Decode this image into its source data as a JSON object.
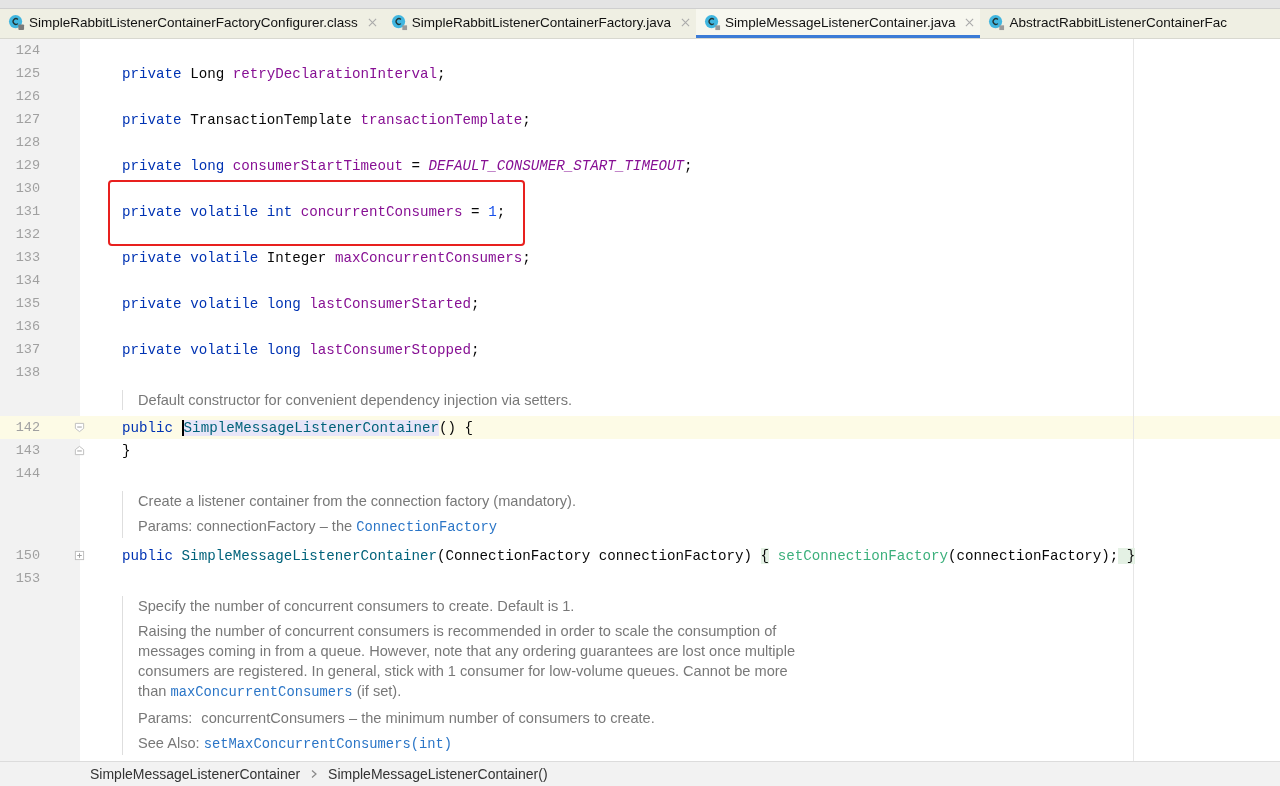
{
  "tabs": [
    {
      "label": "SimpleRabbitListenerContainerFactoryConfigurer.class",
      "kind": "class",
      "selected": false,
      "closable": true
    },
    {
      "label": "SimpleRabbitListenerContainerFactory.java",
      "kind": "java",
      "selected": false,
      "closable": true
    },
    {
      "label": "SimpleMessageListenerContainer.java",
      "kind": "java",
      "selected": true,
      "closable": true
    },
    {
      "label": "AbstractRabbitListenerContainerFac",
      "kind": "java",
      "selected": false,
      "closable": false
    }
  ],
  "lines": [
    {
      "kind": "code",
      "number": "124"
    },
    {
      "kind": "code",
      "number": "125",
      "tokens": [
        {
          "t": "private ",
          "kind": "keyword"
        },
        {
          "t": "Long ",
          "kind": "text"
        },
        {
          "t": "retryDeclarationInterval",
          "kind": "field"
        },
        {
          "t": ";",
          "kind": "text"
        }
      ]
    },
    {
      "kind": "code",
      "number": "126"
    },
    {
      "kind": "code",
      "number": "127",
      "tokens": [
        {
          "t": "private ",
          "kind": "keyword"
        },
        {
          "t": "TransactionTemplate ",
          "kind": "text"
        },
        {
          "t": "transactionTemplate",
          "kind": "field"
        },
        {
          "t": ";",
          "kind": "text"
        }
      ]
    },
    {
      "kind": "code",
      "number": "128"
    },
    {
      "kind": "code",
      "number": "129",
      "tokens": [
        {
          "t": "private ",
          "kind": "keyword"
        },
        {
          "t": "long ",
          "kind": "keyword"
        },
        {
          "t": "consumerStartTimeout",
          "kind": "field"
        },
        {
          "t": " = ",
          "kind": "text"
        },
        {
          "t": "DEFAULT_CONSUMER_START_TIMEOUT",
          "kind": "constant"
        },
        {
          "t": ";",
          "kind": "text"
        }
      ]
    },
    {
      "kind": "code",
      "number": "130"
    },
    {
      "kind": "code",
      "number": "131",
      "marked": true,
      "tokens": [
        {
          "t": "private ",
          "kind": "keyword"
        },
        {
          "t": "volatile ",
          "kind": "keyword"
        },
        {
          "t": "int ",
          "kind": "keyword"
        },
        {
          "t": "concurrentConsumers",
          "kind": "field"
        },
        {
          "t": " = ",
          "kind": "text"
        },
        {
          "t": "1",
          "kind": "number"
        },
        {
          "t": ";",
          "kind": "text"
        }
      ]
    },
    {
      "kind": "code",
      "number": "132"
    },
    {
      "kind": "code",
      "number": "133",
      "tokens": [
        {
          "t": "private ",
          "kind": "keyword"
        },
        {
          "t": "volatile ",
          "kind": "keyword"
        },
        {
          "t": "Integer ",
          "kind": "text"
        },
        {
          "t": "maxConcurrentConsumers",
          "kind": "field"
        },
        {
          "t": ";",
          "kind": "text"
        }
      ]
    },
    {
      "kind": "code",
      "number": "134"
    },
    {
      "kind": "code",
      "number": "135",
      "tokens": [
        {
          "t": "private ",
          "kind": "keyword"
        },
        {
          "t": "volatile ",
          "kind": "keyword"
        },
        {
          "t": "long ",
          "kind": "keyword"
        },
        {
          "t": "lastConsumerStarted",
          "kind": "field"
        },
        {
          "t": ";",
          "kind": "text"
        }
      ]
    },
    {
      "kind": "code",
      "number": "136"
    },
    {
      "kind": "code",
      "number": "137",
      "tokens": [
        {
          "t": "private ",
          "kind": "keyword"
        },
        {
          "t": "volatile ",
          "kind": "keyword"
        },
        {
          "t": "long ",
          "kind": "keyword"
        },
        {
          "t": "lastConsumerStopped",
          "kind": "field"
        },
        {
          "t": ";",
          "kind": "text"
        }
      ]
    },
    {
      "kind": "code",
      "number": "138"
    },
    {
      "kind": "doc",
      "paragraphs": [
        {
          "segments": [
            {
              "t": "Default constructor for convenient dependency injection via setters.",
              "kind": "text"
            }
          ]
        }
      ]
    },
    {
      "kind": "code",
      "number": "142",
      "current": true,
      "fold": {
        "kind": "start"
      },
      "tokens": [
        {
          "t": "public ",
          "kind": "keyword"
        },
        {
          "t": "SimpleMessageListenerContainer",
          "kind": "declaration",
          "selected": true,
          "caret": true
        },
        {
          "t": "() {",
          "kind": "text"
        }
      ]
    },
    {
      "kind": "code",
      "number": "143",
      "fold": {
        "kind": "end"
      },
      "tokens": [
        {
          "t": "}",
          "kind": "text"
        }
      ]
    },
    {
      "kind": "code",
      "number": "144"
    },
    {
      "kind": "doc",
      "paragraphs": [
        {
          "segments": [
            {
              "t": "Create a listener container from the connection factory (mandatory).",
              "kind": "text"
            }
          ]
        },
        {
          "segments": [
            {
              "t": "Params: connectionFactory – the ",
              "kind": "text"
            },
            {
              "t": "ConnectionFactory",
              "kind": "link"
            }
          ]
        }
      ]
    },
    {
      "kind": "code",
      "number": "150",
      "fold": {
        "kind": "collapsed"
      },
      "tokens": [
        {
          "t": "public ",
          "kind": "keyword"
        },
        {
          "t": "SimpleMessageListenerContainer",
          "kind": "declaration"
        },
        {
          "t": "(ConnectionFactory connectionFactory) ",
          "kind": "text"
        },
        {
          "t": "{",
          "kind": "folded"
        },
        {
          "t": "setConnectionFactory",
          "kind": "call"
        },
        {
          "t": "(connectionFactory);",
          "kind": "text"
        },
        {
          "t": " }",
          "kind": "folded"
        }
      ]
    },
    {
      "kind": "code",
      "number": "153"
    },
    {
      "kind": "doc",
      "paragraphs": [
        {
          "segments": [
            {
              "t": "Specify the number of concurrent consumers to create. Default is 1.",
              "kind": "text"
            }
          ]
        },
        {
          "segments": [
            {
              "t": "Raising the number of concurrent consumers is recommended in order to scale the consumption of messages coming in from a queue. However, note that any ordering guarantees are lost once multiple consumers are registered. In general, stick with 1 consumer for low-volume queues. Cannot be more than ",
              "kind": "text"
            },
            {
              "t": "maxConcurrentConsumers",
              "kind": "link"
            },
            {
              "t": " (if set).",
              "kind": "text"
            }
          ]
        },
        {
          "segments": [
            {
              "t": "Params:",
              "kind": "label"
            },
            {
              "t": "concurrentConsumers – the minimum number of consumers to create.",
              "kind": "text"
            }
          ]
        },
        {
          "segments": [
            {
              "t": "See Also: ",
              "kind": "text"
            },
            {
              "t": "setMaxConcurrentConsumers(int)",
              "kind": "link"
            }
          ]
        }
      ]
    }
  ],
  "breadcrumbs": [
    "SimpleMessageListenerContainer",
    "SimpleMessageListenerContainer()"
  ]
}
